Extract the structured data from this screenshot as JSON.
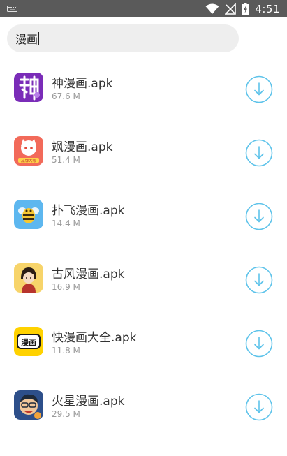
{
  "status_bar": {
    "time": "4:51",
    "icons": [
      "keyboard-icon",
      "wifi-icon",
      "signal-off-icon",
      "battery-charging-icon"
    ]
  },
  "search": {
    "query": "漫画"
  },
  "apps": [
    {
      "name": "神漫画.apk",
      "size": "67.6 M",
      "icon": "shen-manhua-app-icon",
      "action_icon": "download-icon"
    },
    {
      "name": "飒漫画.apk",
      "size": "51.4 M",
      "icon": "sa-manhua-app-icon",
      "action_icon": "download-icon"
    },
    {
      "name": "扑飞漫画.apk",
      "size": "14.4 M",
      "icon": "pufei-manhua-app-icon",
      "action_icon": "download-icon"
    },
    {
      "name": "古风漫画.apk",
      "size": "16.9 M",
      "icon": "gufeng-manhua-app-icon",
      "action_icon": "download-icon"
    },
    {
      "name": "快漫画大全.apk",
      "size": "11.8 M",
      "icon": "kuai-manhua-app-icon",
      "action_icon": "download-icon"
    },
    {
      "name": "火星漫画.apk",
      "size": "29.5 M",
      "icon": "huoxing-manhua-app-icon",
      "action_icon": "download-icon"
    }
  ],
  "icon_text": {
    "kuai": "漫画",
    "sa": "品牌大咖"
  },
  "colors": {
    "accent": "#5ec3ea",
    "status_bar": "#5a5a5a",
    "search_bg": "#eeeeee"
  }
}
